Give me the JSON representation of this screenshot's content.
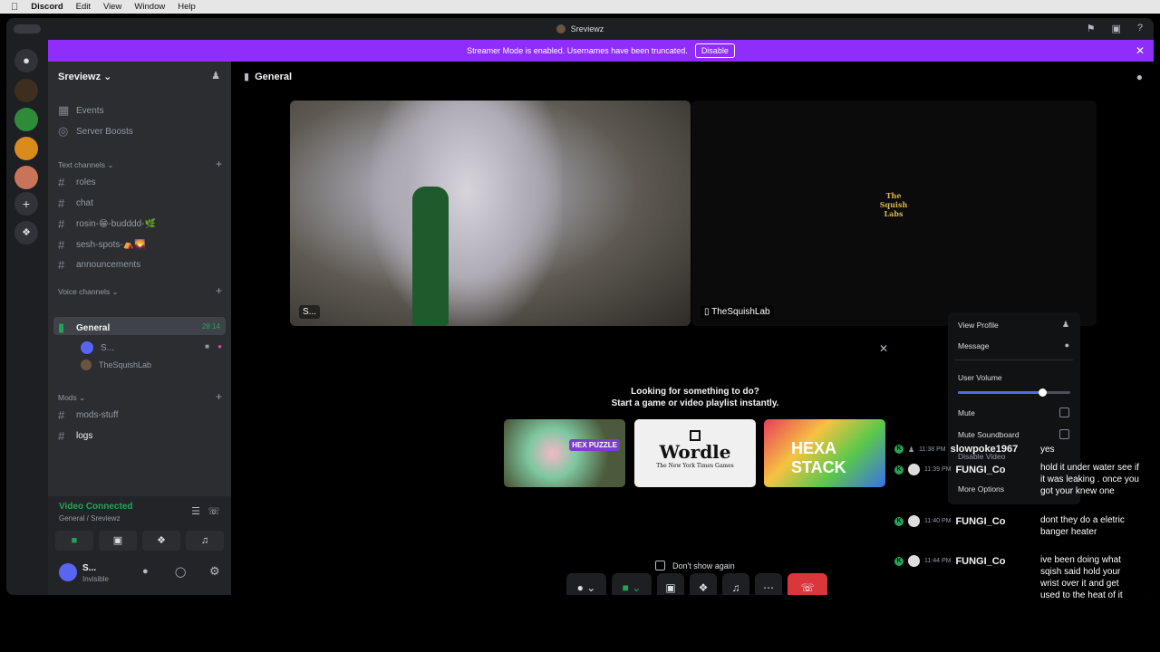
{
  "menubar": {
    "app": "Discord",
    "items": [
      "Edit",
      "View",
      "Window",
      "Help"
    ]
  },
  "window": {
    "title": "Sreviewz"
  },
  "banner": {
    "text": "Streamer Mode is enabled. Usernames have been truncated.",
    "button": "Disable"
  },
  "server": {
    "name": "Sreviewz"
  },
  "sidebar": {
    "events": "Events",
    "boosts": "Server Boosts",
    "text_category": "Text channels",
    "text_channels": [
      "roles",
      "chat",
      "rosin-😁-budddd-🌿",
      "sesh-spots-⛺🌄",
      "announcements"
    ],
    "voice_category": "Voice channels",
    "voice_channel": "General",
    "voice_timer": "28:14",
    "voice_users": [
      "S...",
      "TheSquishLab"
    ],
    "mods_category": "Mods",
    "mods_channels": [
      "mods-stuff",
      "logs"
    ]
  },
  "voice_status": {
    "title": "Video Connected",
    "subtitle": "General / Sreviewz"
  },
  "user": {
    "name": "S...",
    "status": "Invisible"
  },
  "main": {
    "channel": "General",
    "video1_label": "S...",
    "video2_label": "TheSquishLab",
    "logo_text": "The Squish Labs"
  },
  "activity": {
    "line1": "Looking for something to do?",
    "line2": "Start a game or video playlist instantly.",
    "cards": [
      "HEX PUZZLE",
      "Wordle",
      "HEXA STACK"
    ],
    "wordle_sub": "The New York Times Games",
    "dont_show": "Don't show again"
  },
  "context_menu": {
    "view_profile": "View Profile",
    "message": "Message",
    "user_volume": "User Volume",
    "volume_level": 0.75,
    "mute": "Mute",
    "mute_soundboard": "Mute Soundboard",
    "disable_video": "Disable Video",
    "more_options": "More Options"
  },
  "chat": [
    {
      "time": "11:38 PM",
      "name": "slowpoke1967",
      "msg": "yes"
    },
    {
      "time": "11:39 PM",
      "name": "FUNGI_Co",
      "msg": "hold it under water see if it was leaking . once you got your knew one"
    },
    {
      "time": "11:40 PM",
      "name": "FUNGI_Co",
      "msg": "dont they do a eletric banger heater"
    },
    {
      "time": "11:44 PM",
      "name": "FUNGI_Co",
      "msg": "ive been doing what sqish said hold your wrist over it and get used to the heat of it"
    }
  ],
  "colors": {
    "banner": "#8f2dfb",
    "green": "#23a559",
    "hangup": "#da373c",
    "blurple": "#5865f2"
  }
}
